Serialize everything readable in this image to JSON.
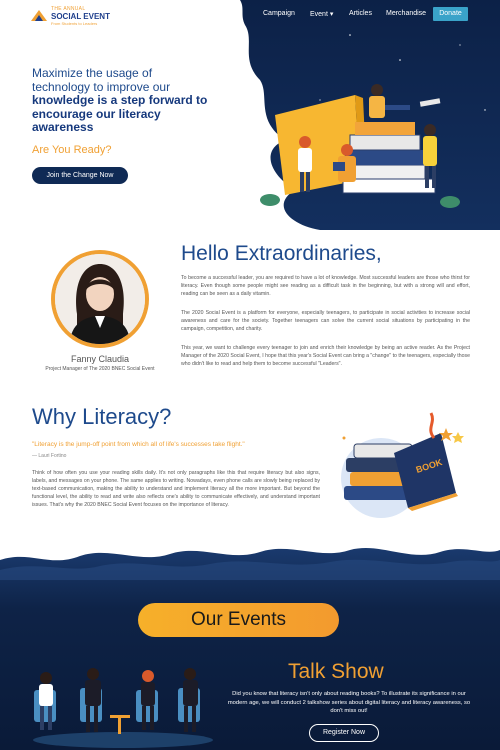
{
  "nav": {
    "logo": {
      "small": "THE ANNUAL",
      "main": "SOCIAL EVENT",
      "tagline": "From Students to Leaders"
    },
    "links": [
      "Campaign",
      "Event",
      "Articles",
      "Merchandise"
    ],
    "event_caret": "▾",
    "donate": "Donate"
  },
  "hero": {
    "headline_lines": [
      "Maximize the usage of",
      "technology to improve our",
      "knowledge is a step forward to",
      "encourage our literacy",
      "awareness"
    ],
    "ready": "Are You Ready?",
    "cta": "Join the Change Now"
  },
  "hello": {
    "title": "Hello Extraordinaries,",
    "name": "Fanny Claudia",
    "role": "Project Manager of The 2020 BNEC Social Event",
    "p1": "To become a successful leader, you are required to have a lot of knowledge. Most successful leaders are those who thirst for literacy. Even though some people might see reading as a difficult task in the beginning, but with a strong will and effort, reading can be seen as a daily vitamin.",
    "p2": "The 2020 Social Event is a platform for everyone, especially teenagers, to participate in social activities to increase social awareness and care for the society. Together teenagers can solve the current social situations by participating in the campaign, competition, and charity.",
    "p3": "This year, we want to challenge every teenager to join and enrich their knowledge by being an active reader. As the Project Manager of the 2020 Social Event, I hope that this year's Social Event can bring a \"change\" to the teenagers, especially those who didn't like to read and help them to become successful \"Leaders\"."
  },
  "why": {
    "title": "Why Literacy?",
    "quote": "\"Literacy is the jump-off point from which all of life's successes take flight.\"",
    "author": "— Lauri Fortino",
    "body": "Think of how often you use your reading skills daily. It's not only paragraphs like this that require literacy but also signs, labels, and messages on your phone. The same applies to writing. Nowadays, even phone calls are slowly being replaced by text-based communication, making the ability to understand and implement literacy all the more important. But beyond the functional level, the ability to read and write also reflects one's ability to communicate effectively, and understand important issues. That's why the 2020 BNEC Social Event focuses on the importance of literacy.",
    "book_label": "BOOK"
  },
  "events": {
    "title": "Our Events",
    "talk_title": "Talk Show",
    "talk_text": "Did you know that literacy isn't only about reading books? To illustrate its significance in our modern age, we will conduct 2 talkshow series about digital literacy and literacy awareness, so don't miss out!",
    "register": "Register Now"
  },
  "colors": {
    "navy": "#0f2a55",
    "heading_blue": "#1e4a8c",
    "accent_orange": "#f0a033",
    "donate_blue": "#3aa3c9"
  }
}
